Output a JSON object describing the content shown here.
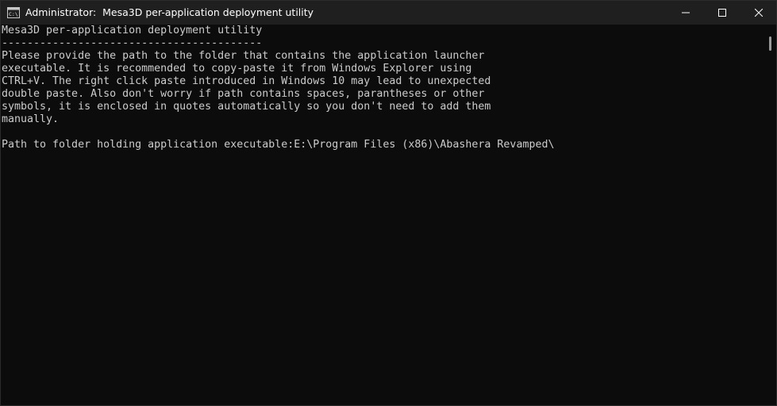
{
  "window": {
    "title": "Administrator:  Mesa3D per-application deployment utility",
    "app_icon": "console-icon"
  },
  "caption_buttons": {
    "minimize": "minimize-icon",
    "maximize": "maximize-icon",
    "close": "close-icon"
  },
  "console": {
    "lines": [
      "Mesa3D per-application deployment utility",
      "-----------------------------------------",
      "Please provide the path to the folder that contains the application launcher",
      "executable. It is recommended to copy-paste it from Windows Explorer using",
      "CTRL+V. The right click paste introduced in Windows 10 may lead to unexpected",
      "double paste. Also don't worry if path contains spaces, parantheses or other",
      "symbols, it is enclosed in quotes automatically so you don't need to add them",
      "manually.",
      "",
      "Path to folder holding application executable:E:\\Program Files (x86)\\Abashera Revamped\\"
    ]
  },
  "colors": {
    "background": "#0c0c0c",
    "titlebar": "#1f1f1f",
    "text": "#cccccc"
  }
}
